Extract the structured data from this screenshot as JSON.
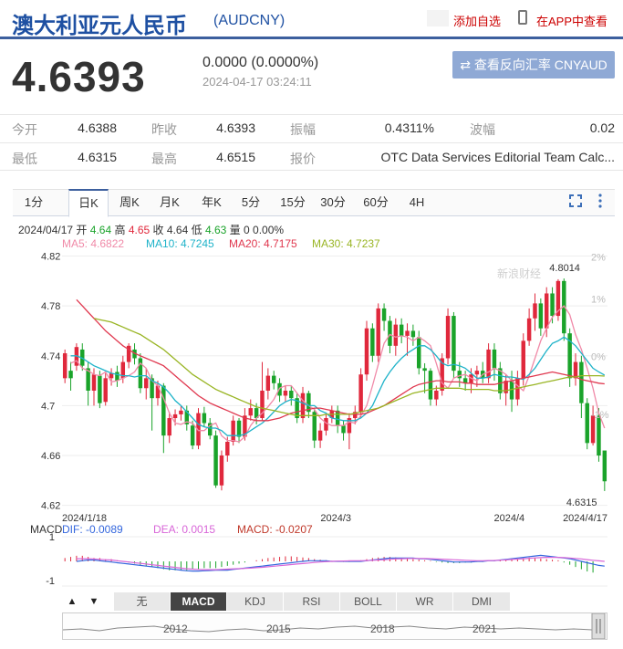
{
  "header": {
    "title": "澳大利亚元人民币",
    "code": "(AUDCNY)",
    "add_fav": "添加自选",
    "app_view": "在APP中查看"
  },
  "quote": {
    "price": "4.6393",
    "change": "0.0000 (0.0000%)",
    "time": "2024-04-17 03:24:11",
    "reverse_btn": "查看反向汇率 CNYAUD"
  },
  "stats": [
    {
      "label": "今开",
      "value": "4.6388"
    },
    {
      "label": "昨收",
      "value": "4.6393"
    },
    {
      "label": "振幅",
      "value": "0.4311%"
    },
    {
      "label": "波幅",
      "value": "0.02"
    },
    {
      "label": "最低",
      "value": "4.6315"
    },
    {
      "label": "最高",
      "value": "4.6515"
    },
    {
      "label": "报价",
      "value": "OTC Data Services Editorial Team Calc..."
    }
  ],
  "tabs": [
    "1分",
    "日K",
    "周K",
    "月K",
    "年K",
    "5分",
    "15分",
    "30分",
    "60分",
    "4H"
  ],
  "active_tab": "日K",
  "info_line": {
    "date": "2024/04/17",
    "open_label": "开",
    "open": "4.64",
    "high_label": "高",
    "high": "4.65",
    "close_label": "收",
    "close": "4.64",
    "low_label": "低",
    "low": "4.63",
    "vol_label": "量",
    "vol": "0",
    "pct": "0.00%"
  },
  "ma_legend": [
    {
      "label": "MA5: 4.6822",
      "color": "#f08aa8"
    },
    {
      "label": "MA10: 4.7245",
      "color": "#1fb3c9"
    },
    {
      "label": "MA20: 4.7175",
      "color": "#e0384f"
    },
    {
      "label": "MA30: 4.7237",
      "color": "#99b524"
    }
  ],
  "macd_legend": {
    "title": "MACD",
    "dif": "DIF: -0.0089",
    "dea": "DEA: 0.0015",
    "macd": "MACD: -0.0207",
    "colors": {
      "dif": "#3366dd",
      "dea": "#d866d8",
      "macd": "#c0392b"
    }
  },
  "indicators": [
    "无",
    "MACD",
    "KDJ",
    "RSI",
    "BOLL",
    "WR",
    "DMI"
  ],
  "active_indicator": "MACD",
  "nav_years": [
    "2012",
    "2015",
    "2018",
    "2021"
  ],
  "colors": {
    "up": "#e0283c",
    "down": "#1aa32a",
    "accent": "#3c5f9e",
    "brand": "#1e50a2"
  },
  "chart_data": {
    "type": "candlestick",
    "ylim": [
      4.6168,
      4.8233
    ],
    "yticks": [
      "4.82",
      "4.78",
      "4.74",
      "4.7",
      "4.66",
      "4.62"
    ],
    "right_ticks": [
      "2%",
      "1%",
      "0%",
      "-1%"
    ],
    "x_labels": [
      "2024/1/18",
      "2024/3",
      "2024/4",
      "2024/4/17"
    ],
    "high_annotation": "4.8014",
    "low_annotation": "4.6315",
    "watermark": "新浪财经",
    "candles": [
      [
        4.722,
        4.742,
        4.718,
        4.745
      ],
      [
        4.728,
        4.722,
        4.712,
        4.735
      ],
      [
        4.732,
        4.747,
        4.728,
        4.75
      ],
      [
        4.745,
        4.732,
        4.728,
        4.75
      ],
      [
        4.73,
        4.712,
        4.7,
        4.735
      ],
      [
        4.712,
        4.725,
        4.7,
        4.73
      ],
      [
        4.724,
        4.702,
        4.698,
        4.728
      ],
      [
        4.703,
        4.722,
        4.7,
        4.726
      ],
      [
        4.722,
        4.726,
        4.716,
        4.73
      ],
      [
        4.727,
        4.72,
        4.715,
        4.732
      ],
      [
        4.722,
        4.735,
        4.718,
        4.74
      ],
      [
        4.735,
        4.748,
        4.73,
        4.75
      ],
      [
        4.745,
        4.738,
        4.733,
        4.75
      ],
      [
        4.738,
        4.714,
        4.71,
        4.742
      ],
      [
        4.714,
        4.722,
        4.705,
        4.73
      ],
      [
        4.722,
        4.706,
        4.68,
        4.725
      ],
      [
        4.706,
        4.716,
        4.7,
        4.72
      ],
      [
        4.716,
        4.676,
        4.662,
        4.718
      ],
      [
        4.676,
        4.69,
        4.67,
        4.695
      ],
      [
        4.69,
        4.693,
        4.684,
        4.697
      ],
      [
        4.693,
        4.696,
        4.688,
        4.7
      ],
      [
        4.696,
        4.685,
        4.68,
        4.7
      ],
      [
        4.684,
        4.668,
        4.665,
        4.688
      ],
      [
        4.668,
        4.694,
        4.665,
        4.698
      ],
      [
        4.694,
        4.686,
        4.683,
        4.699
      ],
      [
        4.686,
        4.676,
        4.673,
        4.69
      ],
      [
        4.676,
        4.636,
        4.634,
        4.68
      ],
      [
        4.636,
        4.66,
        4.632,
        4.664
      ],
      [
        4.66,
        4.671,
        4.655,
        4.675
      ],
      [
        4.671,
        4.688,
        4.668,
        4.692
      ],
      [
        4.688,
        4.675,
        4.67,
        4.69
      ],
      [
        4.675,
        4.692,
        4.672,
        4.698
      ],
      [
        4.692,
        4.698,
        4.688,
        4.705
      ],
      [
        4.698,
        4.69,
        4.685,
        4.702
      ],
      [
        4.69,
        4.712,
        4.688,
        4.735
      ],
      [
        4.712,
        4.724,
        4.705,
        4.73
      ],
      [
        4.724,
        4.718,
        4.713,
        4.728
      ],
      [
        4.718,
        4.708,
        4.703,
        4.722
      ],
      [
        4.708,
        4.712,
        4.703,
        4.716
      ],
      [
        4.712,
        4.706,
        4.7,
        4.716
      ],
      [
        4.706,
        4.69,
        4.686,
        4.71
      ],
      [
        4.69,
        4.71,
        4.686,
        4.715
      ],
      [
        4.71,
        4.695,
        4.69,
        4.712
      ],
      [
        4.695,
        4.672,
        4.666,
        4.698
      ],
      [
        4.672,
        4.68,
        4.666,
        4.686
      ],
      [
        4.68,
        4.69,
        4.676,
        4.694
      ],
      [
        4.69,
        4.696,
        4.686,
        4.7
      ],
      [
        4.696,
        4.684,
        4.678,
        4.7
      ],
      [
        4.684,
        4.678,
        4.672,
        4.688
      ],
      [
        4.678,
        4.69,
        4.665,
        4.694
      ],
      [
        4.69,
        4.695,
        4.685,
        4.7
      ],
      [
        4.695,
        4.725,
        4.69,
        4.73
      ],
      [
        4.725,
        4.762,
        4.72,
        4.768
      ],
      [
        4.762,
        4.74,
        4.735,
        4.766
      ],
      [
        4.74,
        4.778,
        4.735,
        4.782
      ],
      [
        4.778,
        4.768,
        4.76,
        4.782
      ],
      [
        4.768,
        4.748,
        4.742,
        4.772
      ],
      [
        4.748,
        4.765,
        4.74,
        4.77
      ],
      [
        4.765,
        4.756,
        4.75,
        4.77
      ],
      [
        4.756,
        4.76,
        4.74,
        4.766
      ],
      [
        4.76,
        4.755,
        4.748,
        4.765
      ],
      [
        4.755,
        4.73,
        4.725,
        4.76
      ],
      [
        4.73,
        4.728,
        4.71,
        4.734
      ],
      [
        4.728,
        4.705,
        4.7,
        4.73
      ],
      [
        4.705,
        4.712,
        4.7,
        4.716
      ],
      [
        4.712,
        4.738,
        4.708,
        4.742
      ],
      [
        4.738,
        4.772,
        4.733,
        4.778
      ],
      [
        4.772,
        4.728,
        4.722,
        4.775
      ],
      [
        4.728,
        4.722,
        4.715,
        4.735
      ],
      [
        4.722,
        4.718,
        4.712,
        4.728
      ],
      [
        4.718,
        4.725,
        4.71,
        4.73
      ],
      [
        4.725,
        4.728,
        4.715,
        4.732
      ],
      [
        4.728,
        4.722,
        4.718,
        4.735
      ],
      [
        4.722,
        4.745,
        4.718,
        4.75
      ],
      [
        4.745,
        4.73,
        4.72,
        4.75
      ],
      [
        4.73,
        4.71,
        4.705,
        4.735
      ],
      [
        4.71,
        4.72,
        4.7,
        4.725
      ],
      [
        4.72,
        4.705,
        4.695,
        4.728
      ],
      [
        4.705,
        4.722,
        4.7,
        4.728
      ],
      [
        4.722,
        4.752,
        4.716,
        4.758
      ],
      [
        4.752,
        4.77,
        4.748,
        4.778
      ],
      [
        4.77,
        4.782,
        4.76,
        4.79
      ],
      [
        4.782,
        4.762,
        4.756,
        4.786
      ],
      [
        4.762,
        4.79,
        4.755,
        4.795
      ],
      [
        4.79,
        4.772,
        4.766,
        4.795
      ],
      [
        4.772,
        4.8,
        4.768,
        4.8014
      ],
      [
        4.8,
        4.758,
        4.752,
        4.802
      ],
      [
        4.758,
        4.722,
        4.715,
        4.762
      ],
      [
        4.722,
        4.735,
        4.716,
        4.742
      ],
      [
        4.735,
        4.702,
        4.69,
        4.74
      ],
      [
        4.702,
        4.67,
        4.665,
        4.706
      ],
      [
        4.67,
        4.692,
        4.668,
        4.7
      ],
      [
        4.692,
        4.66,
        4.655,
        4.698
      ],
      [
        4.664,
        4.6393,
        4.6315,
        4.6515
      ]
    ],
    "ma5": [
      4.734,
      4.736,
      4.73,
      4.728,
      4.725,
      4.724,
      4.727,
      4.719,
      4.72,
      4.722,
      4.724,
      4.727,
      4.734,
      4.73,
      4.72,
      4.716,
      4.706,
      4.694,
      4.686,
      4.685,
      4.687,
      4.686,
      4.68,
      4.68,
      4.684,
      4.686,
      4.676,
      4.672,
      4.672,
      4.671,
      4.675,
      4.684,
      4.69,
      4.694,
      4.699,
      4.705,
      4.714,
      4.716,
      4.716,
      4.71,
      4.704,
      4.7,
      4.697,
      4.69,
      4.686,
      4.684,
      4.684,
      4.684,
      4.687,
      4.686,
      4.692,
      4.7,
      4.716,
      4.733,
      4.75,
      4.757,
      4.755,
      4.756,
      4.755,
      4.752,
      4.755,
      4.752,
      4.748,
      4.734,
      4.718,
      4.714,
      4.722,
      4.724,
      4.725,
      4.722,
      4.72,
      4.725,
      4.727,
      4.73,
      4.728,
      4.725,
      4.72,
      4.716,
      4.712,
      4.724,
      4.738,
      4.752,
      4.762,
      4.771,
      4.776,
      4.78,
      4.773,
      4.757,
      4.745,
      4.73,
      4.714,
      4.694,
      4.682
    ],
    "ma10": [
      4.74,
      4.74,
      4.738,
      4.735,
      4.732,
      4.73,
      4.728,
      4.726,
      4.725,
      4.724,
      4.724,
      4.723,
      4.724,
      4.724,
      4.72,
      4.718,
      4.715,
      4.71,
      4.704,
      4.7,
      4.695,
      4.69,
      4.685,
      4.683,
      4.682,
      4.682,
      4.68,
      4.676,
      4.676,
      4.676,
      4.677,
      4.68,
      4.683,
      4.686,
      4.69,
      4.695,
      4.7,
      4.703,
      4.705,
      4.704,
      4.702,
      4.7,
      4.7,
      4.696,
      4.694,
      4.69,
      4.689,
      4.688,
      4.688,
      4.688,
      4.69,
      4.694,
      4.7,
      4.71,
      4.72,
      4.727,
      4.733,
      4.738,
      4.742,
      4.745,
      4.748,
      4.748,
      4.745,
      4.74,
      4.734,
      4.732,
      4.733,
      4.732,
      4.73,
      4.726,
      4.722,
      4.722,
      4.723,
      4.725,
      4.724,
      4.723,
      4.723,
      4.722,
      4.721,
      4.725,
      4.73,
      4.737,
      4.744,
      4.75,
      4.752,
      4.755,
      4.752,
      4.748,
      4.742,
      4.736,
      4.73,
      4.727,
      4.7245
    ],
    "ma20": [
      4.785,
      4.78,
      4.775,
      4.77,
      4.765,
      4.76,
      4.756,
      4.752,
      4.748,
      4.745,
      4.742,
      4.74,
      4.738,
      4.736,
      4.734,
      4.732,
      4.728,
      4.724,
      4.72,
      4.716,
      4.712,
      4.708,
      4.705,
      4.702,
      4.7,
      4.698,
      4.696,
      4.694,
      4.692,
      4.69,
      4.689,
      4.688,
      4.688,
      4.688,
      4.689,
      4.69,
      4.692,
      4.694,
      4.695,
      4.696,
      4.697,
      4.698,
      4.698,
      4.697,
      4.696,
      4.695,
      4.694,
      4.693,
      4.693,
      4.693,
      4.694,
      4.696,
      4.698,
      4.7,
      4.703,
      4.706,
      4.709,
      4.712,
      4.715,
      4.717,
      4.718,
      4.719,
      4.72,
      4.72,
      4.719,
      4.719,
      4.719,
      4.718,
      4.718,
      4.717,
      4.717,
      4.717,
      4.717,
      4.718,
      4.719,
      4.72,
      4.721,
      4.722,
      4.723,
      4.724,
      4.725,
      4.726,
      4.727,
      4.726,
      4.725,
      4.724,
      4.723,
      4.721,
      4.72,
      4.719,
      4.718,
      4.7175
    ],
    "ma30": [
      4.77,
      4.769,
      4.768,
      4.767,
      4.765,
      4.763,
      4.761,
      4.759,
      4.757,
      4.754,
      4.751,
      4.748,
      4.745,
      4.741,
      4.737,
      4.733,
      4.729,
      4.725,
      4.722,
      4.719,
      4.716,
      4.713,
      4.711,
      4.709,
      4.707,
      4.705,
      4.703,
      4.701,
      4.699,
      4.698,
      4.697,
      4.696,
      4.695,
      4.694,
      4.693,
      4.692,
      4.692,
      4.692,
      4.692,
      4.692,
      4.693,
      4.693,
      4.693,
      4.693,
      4.693,
      4.694,
      4.695,
      4.696,
      4.697,
      4.698,
      4.7,
      4.702,
      4.704,
      4.706,
      4.708,
      4.71,
      4.711,
      4.712,
      4.713,
      4.714,
      4.714,
      4.714,
      4.714,
      4.714,
      4.713,
      4.713,
      4.713,
      4.713,
      4.713,
      4.712,
      4.712,
      4.712,
      4.713,
      4.714,
      4.715,
      4.716,
      4.717,
      4.718,
      4.719,
      4.72,
      4.721,
      4.722,
      4.723,
      4.723,
      4.724,
      4.724,
      4.724,
      4.724,
      4.7237
    ],
    "macd_hist": [
      0.3,
      0.4,
      0.5,
      0.5,
      0.4,
      0.3,
      0.3,
      0.2,
      0.2,
      0.1,
      0.0,
      -0.1,
      -0.2,
      -0.3,
      -0.4,
      -0.5,
      -0.6,
      -0.7,
      -0.8,
      -0.8,
      -0.8,
      -0.8,
      -0.7,
      -0.7,
      -0.6,
      -0.6,
      -0.6,
      -0.5,
      -0.4,
      -0.3,
      -0.2,
      -0.1,
      0.0,
      0.1,
      0.2,
      0.3,
      0.35,
      0.4,
      0.45,
      0.45,
      0.4,
      0.35,
      0.3,
      0.2,
      0.15,
      0.1,
      0.05,
      0.0,
      -0.05,
      -0.05,
      0.0,
      0.1,
      0.2,
      0.3,
      0.35,
      0.4,
      0.4,
      0.35,
      0.3,
      0.25,
      0.2,
      0.15,
      0.1,
      0.05,
      -0.05,
      -0.1,
      -0.15,
      -0.15,
      -0.15,
      -0.1,
      -0.1,
      -0.05,
      -0.05,
      0.0,
      0.05,
      0.1,
      0.15,
      0.2,
      0.25,
      0.3,
      0.35,
      0.3,
      0.25,
      0.2,
      0.15,
      0.1,
      -0.1,
      -0.3,
      -0.5,
      -0.7,
      -0.9,
      -1.0
    ],
    "macd_dif": [
      0.0,
      0.05,
      0.1,
      0.1,
      0.05,
      0.0,
      -0.05,
      -0.1,
      -0.15,
      -0.2,
      -0.25,
      -0.3,
      -0.35,
      -0.4,
      -0.45,
      -0.5,
      -0.55,
      -0.6,
      -0.65,
      -0.7,
      -0.72,
      -0.72,
      -0.7,
      -0.68,
      -0.66,
      -0.65,
      -0.65,
      -0.6,
      -0.55,
      -0.5,
      -0.45,
      -0.4,
      -0.35,
      -0.3,
      -0.25,
      -0.2,
      -0.15,
      -0.1,
      -0.05,
      0.0,
      0.05,
      0.05,
      0.05,
      0.05,
      0.0,
      0.0,
      0.0,
      0.0,
      0.0,
      0.0,
      0.05,
      0.1,
      0.15,
      0.2,
      0.25,
      0.25,
      0.25,
      0.25,
      0.25,
      0.2,
      0.2,
      0.15,
      0.1,
      0.05,
      0.0,
      -0.05,
      -0.05,
      -0.05,
      -0.05,
      0.0,
      0.0,
      0.05,
      0.05,
      0.1,
      0.15,
      0.2,
      0.25,
      0.3,
      0.35,
      0.4,
      0.45,
      0.4,
      0.35,
      0.3,
      0.25,
      0.2,
      0.1,
      0.0,
      -0.1,
      -0.2,
      -0.3,
      -0.35
    ],
    "macd_dea": [
      0.2,
      0.2,
      0.2,
      0.18,
      0.15,
      0.12,
      0.1,
      0.05,
      0.0,
      -0.05,
      -0.1,
      -0.15,
      -0.2,
      -0.25,
      -0.3,
      -0.35,
      -0.4,
      -0.45,
      -0.5,
      -0.55,
      -0.58,
      -0.6,
      -0.62,
      -0.62,
      -0.62,
      -0.6,
      -0.58,
      -0.56,
      -0.54,
      -0.52,
      -0.5,
      -0.47,
      -0.44,
      -0.4,
      -0.36,
      -0.32,
      -0.28,
      -0.24,
      -0.2,
      -0.16,
      -0.12,
      -0.08,
      -0.05,
      -0.02,
      0.0,
      0.02,
      0.03,
      0.04,
      0.05,
      0.05,
      0.06,
      0.08,
      0.1,
      0.12,
      0.15,
      0.18,
      0.2,
      0.21,
      0.22,
      0.22,
      0.21,
      0.2,
      0.18,
      0.16,
      0.14,
      0.12,
      0.1,
      0.08,
      0.06,
      0.05,
      0.05,
      0.06,
      0.07,
      0.09,
      0.11,
      0.14,
      0.17,
      0.2,
      0.23,
      0.26,
      0.28,
      0.3,
      0.3,
      0.3,
      0.28,
      0.25,
      0.22,
      0.18,
      0.13,
      0.08,
      0.04,
      0.0
    ]
  }
}
